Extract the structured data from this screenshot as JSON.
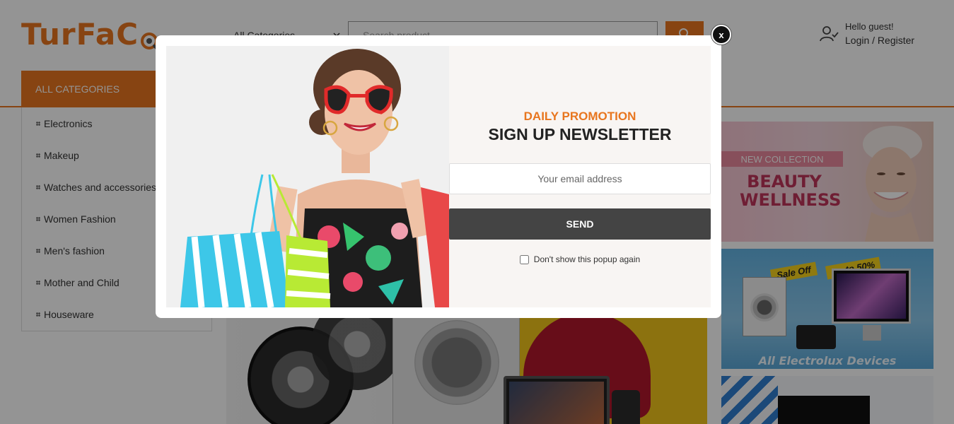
{
  "header": {
    "logo_text": "TurFaC",
    "category_select": "All Categories",
    "search_placeholder": "Search product...",
    "user": {
      "greeting": "Hello guest!",
      "login_register": "Login / Register"
    }
  },
  "navbar": {
    "all_categories_label": "ALL CATEGORIES"
  },
  "sidebar": {
    "items": [
      {
        "label": "Electronics"
      },
      {
        "label": "Makeup"
      },
      {
        "label": "Watches and accessories"
      },
      {
        "label": "Women Fashion"
      },
      {
        "label": "Men's fashion"
      },
      {
        "label": "Mother and Child"
      },
      {
        "label": "Houseware"
      }
    ]
  },
  "banners": {
    "beauty": {
      "tag": "NEW COLLECTION",
      "title_line1": "BEAUTY",
      "title_line2": "WELLNESS"
    },
    "electrolux": {
      "sale_tag": "Sale Off",
      "upto_tag": "up to 50%",
      "caption": "All Electrolux Devices"
    }
  },
  "popup": {
    "subtitle": "DAILY PROMOTION",
    "title": "SIGN UP NEWSLETTER",
    "email_placeholder": "Your email address",
    "send_label": "SEND",
    "dont_show_label": "Don't show this popup again",
    "close_label": "x"
  },
  "colors": {
    "accent": "#e8761f",
    "button_dark": "#444444",
    "overlay": "rgba(0,0,0,0.42)"
  },
  "icons": [
    "logo-pin-icon",
    "chevron-down-icon",
    "search-icon",
    "user-icon",
    "close-icon",
    "bullet-icon"
  ]
}
